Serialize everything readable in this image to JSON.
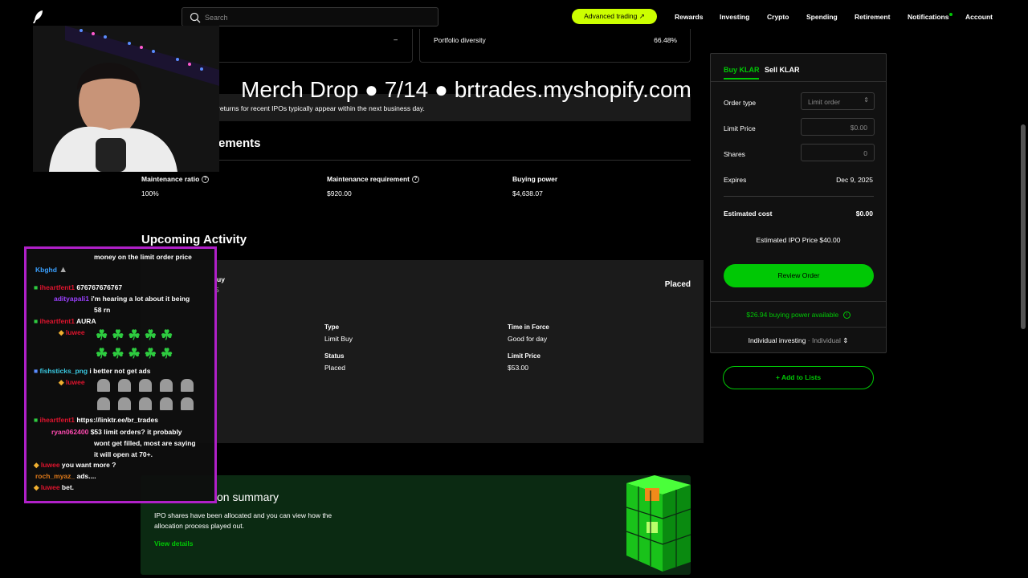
{
  "nav": {
    "search_placeholder": "Search",
    "advanced_trading": "Advanced trading ↗",
    "links": [
      "Rewards",
      "Investing",
      "Crypto",
      "Spending",
      "Retirement",
      "Notifications",
      "Account"
    ]
  },
  "top_cards": {
    "left_value": "–",
    "diversity_label": "Portfolio diversity",
    "diversity_value": "66.48%"
  },
  "overlay_title": "Merch Drop ● 7/14 ● brtrades.myshopify.com",
  "notice_text": "d returns for recent IPOs typically appear within the next business day.",
  "requirements": {
    "heading": "ements",
    "items": [
      {
        "label": "Maintenance ratio",
        "value": "100%"
      },
      {
        "label": "Maintenance requirement",
        "value": "$920.00"
      },
      {
        "label": "Buying power",
        "value": "$4,638.07"
      }
    ]
  },
  "upcoming": {
    "heading": "Upcoming Activity",
    "order_title_frag": "uy",
    "order_sub_frag": "5",
    "status_badge": "Placed",
    "fields": [
      {
        "label": "Type",
        "value": "Limit Buy"
      },
      {
        "label": "Time in Force",
        "value": "Good for day"
      },
      {
        "label": "Status",
        "value": "Placed"
      },
      {
        "label": "Limit Price",
        "value": "$53.00"
      }
    ]
  },
  "allocation": {
    "heading": "on summary",
    "body_line1": "IPO shares have been allocated and you can view how the",
    "body_line2": "allocation process played out.",
    "link": "View details"
  },
  "order_panel": {
    "tab_buy": "Buy KLAR",
    "tab_sell": "Sell KLAR",
    "order_type_label": "Order type",
    "order_type_value": "Limit order",
    "limit_price_label": "Limit Price",
    "limit_price_value": "$0.00",
    "shares_label": "Shares",
    "shares_value": "0",
    "expires_label": "Expires",
    "expires_value": "Dec 9, 2025",
    "est_cost_label": "Estimated cost",
    "est_cost_value": "$0.00",
    "est_ipo_price": "Estimated IPO Price $40.00",
    "review_button": "Review Order",
    "buying_power": "$26.94 buying power available",
    "account_label": "Individual investing",
    "account_sub": "· Individual",
    "add_to_lists": "Add to Lists"
  },
  "chat": [
    {
      "user": "",
      "text": "money on the limit order price"
    },
    {
      "user": "Kbghd",
      "text": ""
    },
    {
      "user": "iheartfent1",
      "text": "676767676767"
    },
    {
      "user": "adityapali1",
      "text": "i'm hearing a lot about it being"
    },
    {
      "user": "",
      "text": "58 rn"
    },
    {
      "user": "iheartfent1",
      "text": "AURA"
    },
    {
      "user": "luwee",
      "text": ""
    },
    {
      "user": "fishsticks_png",
      "text": "i better not get ads"
    },
    {
      "user": "luwee",
      "text": ""
    },
    {
      "user": "iheartfent1",
      "text": "https://linktr.ee/br_trades"
    },
    {
      "user": "ryan062400",
      "text": "$53 limit orders? it probably"
    },
    {
      "user": "",
      "text": "wont get filled, most are saying"
    },
    {
      "user": "",
      "text": "it will open at 70+."
    },
    {
      "user": "luwee",
      "text": "you want more ?"
    },
    {
      "user": "roch_myaz_",
      "text": "ads...."
    },
    {
      "user": "luwee",
      "text": "bet."
    }
  ],
  "colors": {
    "accent_green": "#00c805",
    "lime": "#ccff00",
    "chat_border": "#b020c8"
  }
}
